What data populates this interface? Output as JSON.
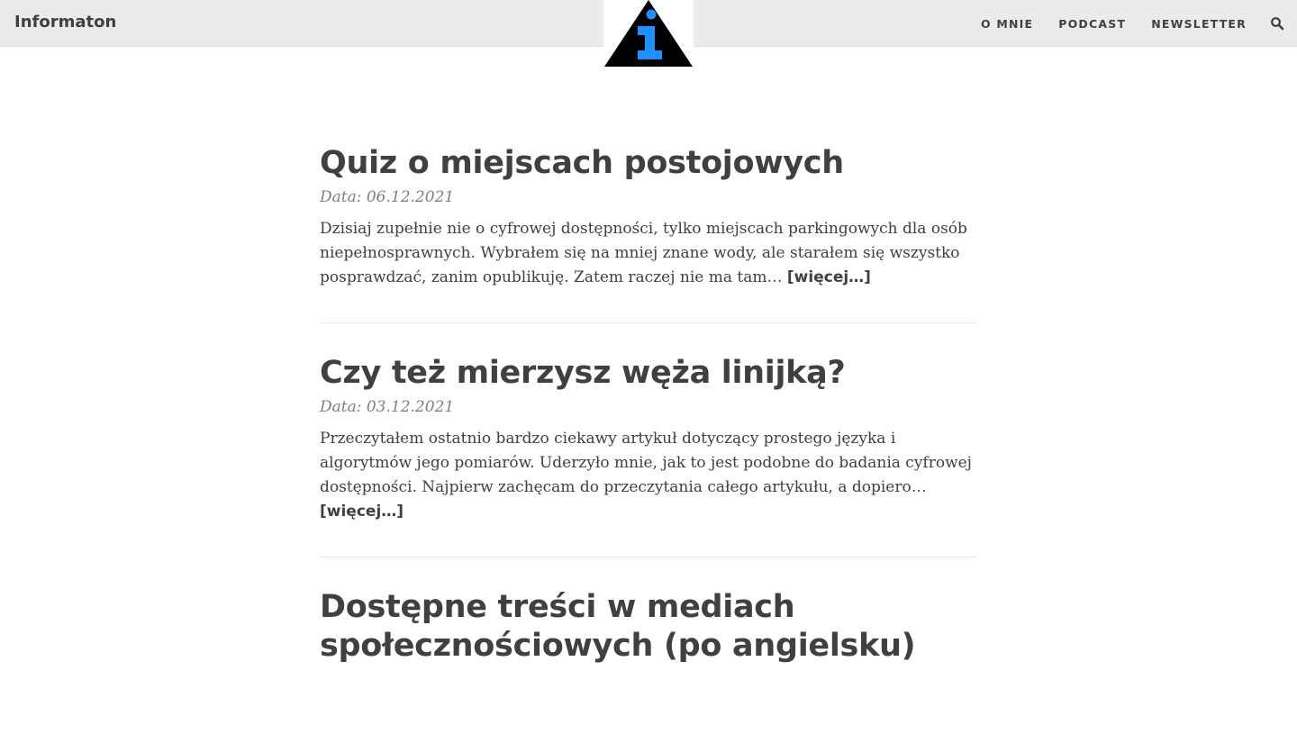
{
  "header": {
    "brand": "Informaton",
    "logo_icon": "info-triangle-icon",
    "logo_colors": {
      "triangle": "#000000",
      "info": "#1e90ff"
    },
    "nav": [
      {
        "label": "O MNIE"
      },
      {
        "label": "PODCAST"
      },
      {
        "label": "NEWSLETTER"
      }
    ],
    "search_icon": "search-icon"
  },
  "posts": [
    {
      "title": "Quiz o miejscach postojowych",
      "date": "Data: 06.12.2021",
      "excerpt": "Dzisiaj zupełnie nie o cyfrowej dostępności, tylko miejscach parkingowych dla osób niepełnosprawnych. Wybrałem się na mniej znane wody, ale starałem się wszystko posprawdzać, zanim opublikuję. Zatem raczej nie ma tam…",
      "more": "[więcej…]"
    },
    {
      "title": "Czy też mierzysz węża linijką?",
      "date": "Data: 03.12.2021",
      "excerpt": "Przeczytałem ostatnio bardzo ciekawy artykuł dotyczący prostego języka i algorytmów jego pomiarów. Uderzyło mnie, jak to jest podobne do badania cyfrowej dostępności. Najpierw zachęcam do przeczytania całego artykułu, a dopiero…",
      "more": "[więcej…]"
    },
    {
      "title": "Dostępne treści w mediach społecznościowych (po angielsku)"
    }
  ]
}
